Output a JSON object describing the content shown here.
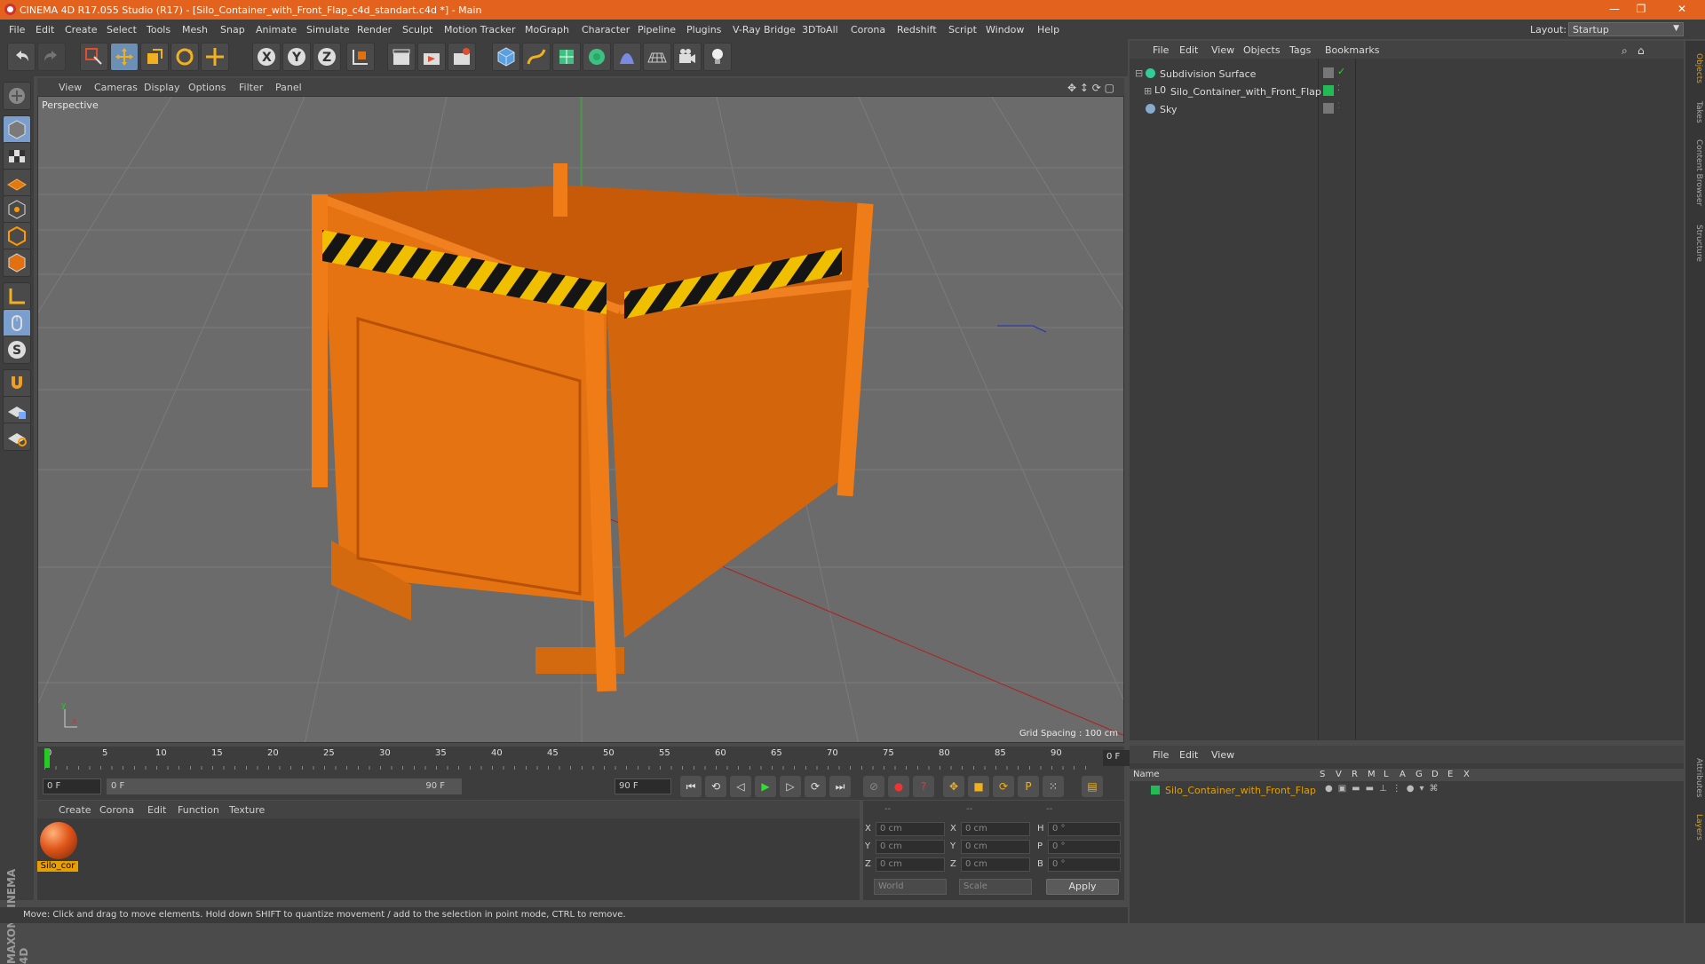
{
  "window": {
    "title": "CINEMA 4D R17.055 Studio (R17) - [Silo_Container_with_Front_Flap_c4d_standart.c4d *] - Main",
    "minimize": "—",
    "restore": "❐",
    "close": "✕"
  },
  "menubar": {
    "items": [
      "File",
      "Edit",
      "Create",
      "Select",
      "Tools",
      "Mesh",
      "Snap",
      "Animate",
      "Simulate",
      "Render",
      "Sculpt",
      "Motion Tracker",
      "MoGraph",
      "Character",
      "Pipeline",
      "Plugins",
      "V-Ray Bridge",
      "3DToAll",
      "Corona",
      "Redshift",
      "Script",
      "Window",
      "Help"
    ],
    "layout_label": "Layout:",
    "layout_value": "Startup"
  },
  "viewport": {
    "menu": [
      "View",
      "Cameras",
      "Display",
      "Options",
      "Filter",
      "Panel"
    ],
    "name": "Perspective",
    "grid_spacing": "Grid Spacing : 100 cm"
  },
  "timeline": {
    "ticks": [
      "0",
      "5",
      "10",
      "15",
      "20",
      "25",
      "30",
      "35",
      "40",
      "45",
      "50",
      "55",
      "60",
      "65",
      "70",
      "75",
      "80",
      "85",
      "90"
    ],
    "current_frame": "0 F",
    "start": "0 F",
    "range_start": "0 F",
    "range_end": "90 F",
    "end": "90 F"
  },
  "material_panel": {
    "menu": [
      "Create",
      "Corona",
      "Edit",
      "Function",
      "Texture"
    ],
    "material_name": "Silo_cor"
  },
  "coords": {
    "headers": [
      "--",
      "--",
      "--"
    ],
    "rows": [
      {
        "a": "X",
        "av": "0 cm",
        "b": "X",
        "bv": "0 cm",
        "c": "H",
        "cv": "0 °"
      },
      {
        "a": "Y",
        "av": "0 cm",
        "b": "Y",
        "bv": "0 cm",
        "c": "P",
        "cv": "0 °"
      },
      {
        "a": "Z",
        "av": "0 cm",
        "b": "Z",
        "bv": "0 cm",
        "c": "B",
        "cv": "0 °"
      }
    ],
    "world": "World",
    "scale": "Scale",
    "apply": "Apply"
  },
  "status": "Move: Click and drag to move elements. Hold down SHIFT to quantize movement / add to the selection in point mode, CTRL to remove.",
  "object_manager": {
    "menu": [
      "File",
      "Edit",
      "View",
      "Objects",
      "Tags",
      "Bookmarks"
    ],
    "objects": [
      "Subdivision Surface",
      "Silo_Container_with_Front_Flap",
      "Sky"
    ]
  },
  "layer_manager": {
    "menu": [
      "File",
      "Edit",
      "View"
    ],
    "columns": [
      "Name",
      "S",
      "V",
      "R",
      "M",
      "L",
      "A",
      "G",
      "D",
      "E",
      "X"
    ],
    "row_name": "Silo_Container_with_Front_Flap"
  },
  "side_tabs": [
    "Objects",
    "Takes",
    "Content Browser",
    "Structure",
    "Attributes",
    "Layers"
  ],
  "brand": "MAXON CINEMA 4D",
  "colors": {
    "accent": "#e2621e",
    "object_orange": "#e07410",
    "highlight": "#e2a000"
  }
}
